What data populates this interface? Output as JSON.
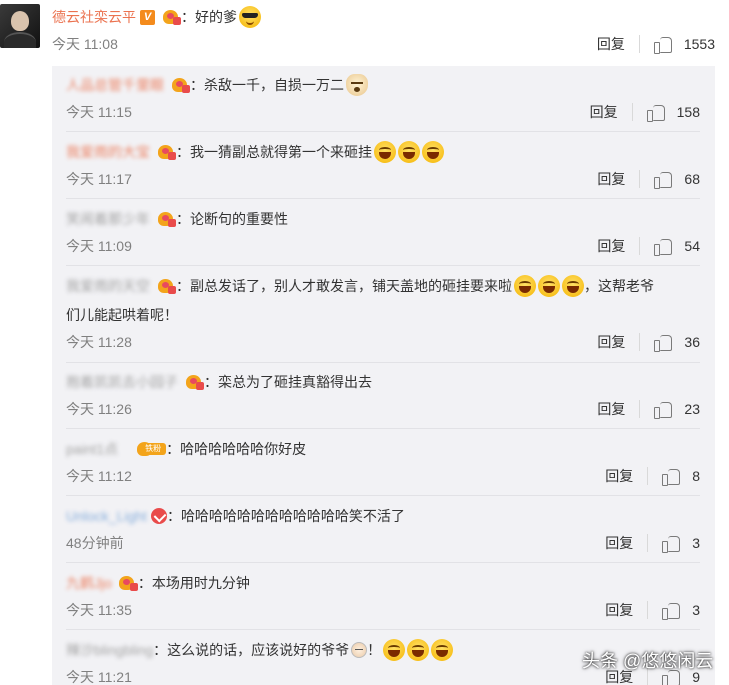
{
  "main": {
    "username": "德云社栾云平",
    "v_badge": "V",
    "colon": "：",
    "text": "好的爹",
    "emoji": "cool-emoji",
    "time": "今天 11:08",
    "reply": "回复",
    "likes": "1553"
  },
  "replies": [
    {
      "username": "人品总管千里眼",
      "colon": "：",
      "text": "杀敌一千，自损一万二",
      "emojis": [
        "doge-emoji"
      ],
      "time": "今天 11:15",
      "reply": "回复",
      "likes": "158"
    },
    {
      "username": "我爱雨的大宝",
      "colon": "：",
      "text": "我一猜副总就得第一个来砸挂",
      "emojis": [
        "laugh-emoji",
        "laugh-emoji",
        "laugh-emoji"
      ],
      "time": "今天 11:17",
      "reply": "回复",
      "likes": "68"
    },
    {
      "username": "笑闹着那少年",
      "colon": "：",
      "text": "论断句的重要性",
      "emojis": [],
      "time": "今天 11:09",
      "reply": "回复",
      "likes": "54"
    },
    {
      "username": "我爱雨的天空",
      "colon": "：",
      "text": "副总发话了，别人才敢发言，铺天盖地的砸挂要来啦",
      "text_after": "，这帮老爷",
      "text_line2": "们儿能起哄着呢！",
      "emojis": [
        "laugh-emoji",
        "laugh-emoji",
        "laugh-emoji"
      ],
      "time": "今天 11:28",
      "reply": "回复",
      "likes": "36"
    },
    {
      "username": "抱着凯凯去小园子",
      "colon": "：",
      "text": "栾总为了砸挂真豁得出去",
      "emojis": [],
      "time": "今天 11:26",
      "reply": "回复",
      "likes": "23"
    },
    {
      "username": "paint1点",
      "badge_label": "铁粉",
      "colon": "：",
      "text": "哈哈哈哈哈哈你好皮",
      "emojis": [],
      "time": "今天 11:12",
      "reply": "回复",
      "likes": "8"
    },
    {
      "username": "Unlock_Light",
      "colon": "：",
      "text": "哈哈哈哈哈哈哈哈哈哈哈哈笑不活了",
      "emojis": [],
      "time": "48分钟前",
      "reply": "回复",
      "likes": "3"
    },
    {
      "username": "九鹤Jjo",
      "colon": "：",
      "text": "本场用时九分钟",
      "emojis": [],
      "time": "今天 11:35",
      "reply": "回复",
      "likes": "3"
    },
    {
      "username": "辣沙blingbling",
      "colon": "：",
      "text": "这么说的话，应该说好的爷爷",
      "text_after": "！",
      "emojis": [
        "laugh-emoji",
        "laugh-emoji",
        "laugh-emoji"
      ],
      "time": "今天 11:21",
      "reply": "回复",
      "likes": "9"
    }
  ],
  "watermark": "头条 @悠悠闲云",
  "colors": {
    "username": "#eb7350",
    "panel_bg": "#f2f2f5",
    "time": "#808080"
  }
}
